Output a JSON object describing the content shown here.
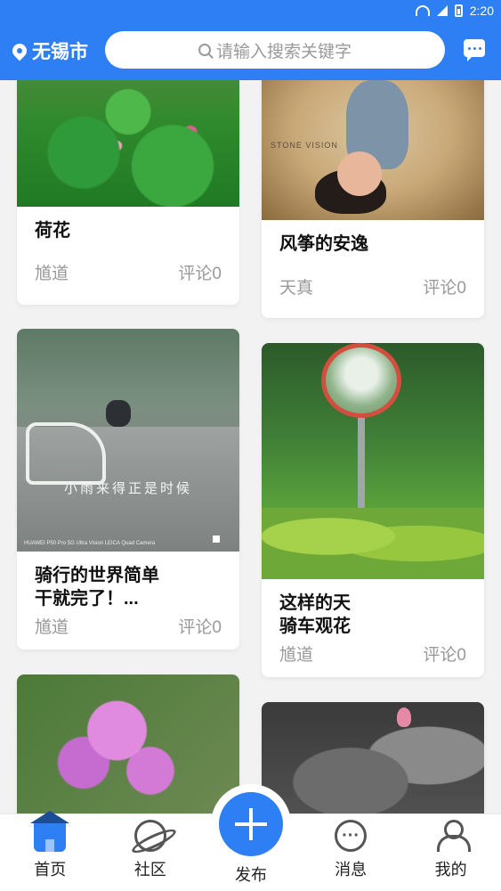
{
  "status_bar": {
    "time": "2:20"
  },
  "header": {
    "location": "无锡市",
    "search_placeholder": "请输入搜索关键字"
  },
  "posts": [
    {
      "title": "荷花",
      "author": "馗道",
      "comments": "评论0"
    },
    {
      "title": "风筝的安逸",
      "author": "天真",
      "comments": "评论0",
      "watermark": "STONE VISION"
    },
    {
      "title": "骑行的世界简单\n干就完了！...",
      "author": "馗道",
      "comments": "评论0",
      "caption": "小雨来得正是时候",
      "camera": "HUAWEI P50 Pro 5G  Ultra Vision LEICA Quad Camera"
    },
    {
      "title": "这样的天\n骑车观花",
      "author": "馗道",
      "comments": "评论0"
    },
    {
      "title": "",
      "author": "",
      "comments": ""
    },
    {
      "title": "",
      "author": "",
      "comments": ""
    }
  ],
  "nav": {
    "home": "首页",
    "community": "社区",
    "publish": "发布",
    "messages": "消息",
    "mine": "我的"
  },
  "colors": {
    "primary": "#2f7ff4"
  }
}
